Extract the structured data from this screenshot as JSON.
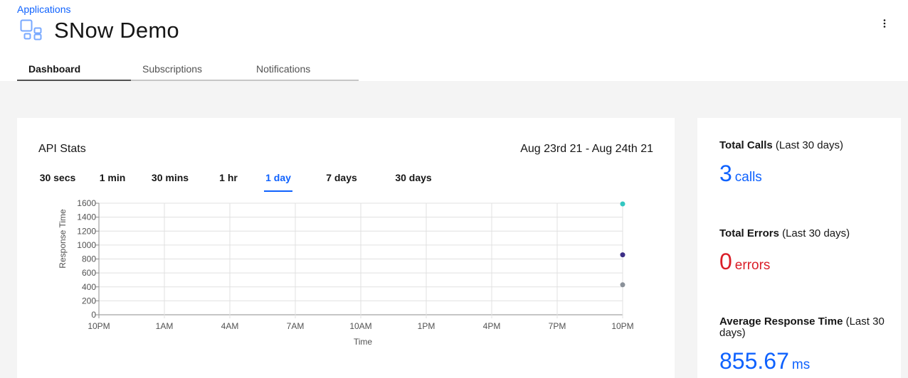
{
  "breadcrumb": {
    "label": "Applications"
  },
  "page": {
    "title": "SNow Demo",
    "icon": "application-icon"
  },
  "tabs": [
    {
      "label": "Dashboard",
      "active": true
    },
    {
      "label": "Subscriptions",
      "active": false
    },
    {
      "label": "Notifications",
      "active": false
    }
  ],
  "api_stats": {
    "title": "API Stats",
    "date_range": "Aug 23rd 21 - Aug 24th 21",
    "time_ranges": [
      {
        "label": "30 secs",
        "active": false
      },
      {
        "label": "1 min",
        "active": false
      },
      {
        "label": "30 mins",
        "active": false
      },
      {
        "label": "1 hr",
        "active": false
      },
      {
        "label": "1 day",
        "active": true
      },
      {
        "label": "7 days",
        "active": false
      },
      {
        "label": "30 days",
        "active": false
      }
    ]
  },
  "chart_data": {
    "type": "scatter",
    "title": "",
    "xlabel": "Time",
    "ylabel": "Response Time",
    "x_ticks": [
      "10PM",
      "1AM",
      "4AM",
      "7AM",
      "10AM",
      "1PM",
      "4PM",
      "7PM",
      "10PM"
    ],
    "y_ticks": [
      0,
      200,
      400,
      600,
      800,
      1000,
      1200,
      1400,
      1600
    ],
    "ylim": [
      0,
      1600
    ],
    "grid": true,
    "points": [
      {
        "x": "10PM",
        "y": 1590,
        "color": "#33c7c1"
      },
      {
        "x": "10PM",
        "y": 860,
        "color": "#3c2e86"
      },
      {
        "x": "10PM",
        "y": 430,
        "color": "#8a9199"
      }
    ]
  },
  "totals": {
    "calls": {
      "label": "Total Calls",
      "period": "(Last 30 days)",
      "value": "3",
      "unit": "calls"
    },
    "errors": {
      "label": "Total Errors",
      "period": "(Last 30 days)",
      "value": "0",
      "unit": "errors"
    },
    "response": {
      "label": "Average Response Time",
      "period": "(Last 30 days)",
      "value": "855.67",
      "unit": "ms"
    }
  },
  "colors": {
    "accent": "#0f62fe",
    "error": "#da1e28",
    "background": "#f4f4f4"
  }
}
